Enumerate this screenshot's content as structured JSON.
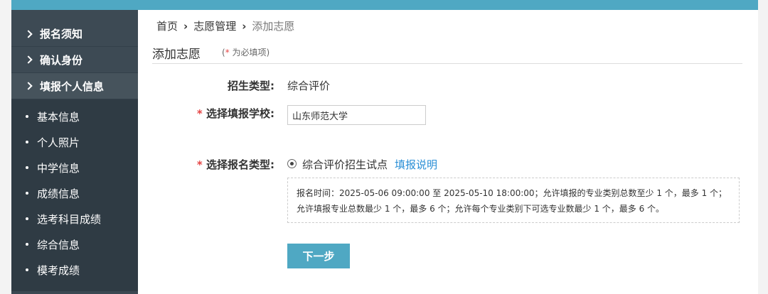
{
  "sidebar": {
    "headers": [
      "报名须知",
      "确认身份",
      "填报个人信息"
    ],
    "items": [
      "基本信息",
      "个人照片",
      "中学信息",
      "成绩信息",
      "选考科目成绩",
      "综合信息",
      "模考成绩"
    ]
  },
  "breadcrumb": {
    "home": "首页",
    "section": "志愿管理",
    "current": "添加志愿"
  },
  "page_title": "添加志愿",
  "required_note": {
    "open": "(",
    "star": "*",
    "text": " 为必填项)"
  },
  "form": {
    "admission_type_label": "招生类型:",
    "admission_type_value": "综合评价",
    "school_label": "选择填报学校:",
    "school_value": "山东师范大学",
    "apply_type_label": "选择报名类型:",
    "apply_type_option": "综合评价招生试点",
    "help_link": "填报说明",
    "star": "*",
    "info_line1": "报名时间：2025-05-06 09:00:00 至 2025-05-10 18:00:00；允许填报的专业类别总数至少 1 个，最多 1 个；",
    "info_line2": "允许填报专业总数最少 1 个，最多 6 个；允许每个专业类别下可选专业数最少 1 个，最多 6 个。",
    "next_button": "下一步"
  },
  "colors": {
    "accent": "#4fa8c3",
    "sidebar": "#3b4852",
    "link": "#2a8fd6",
    "required": "#e54545"
  }
}
